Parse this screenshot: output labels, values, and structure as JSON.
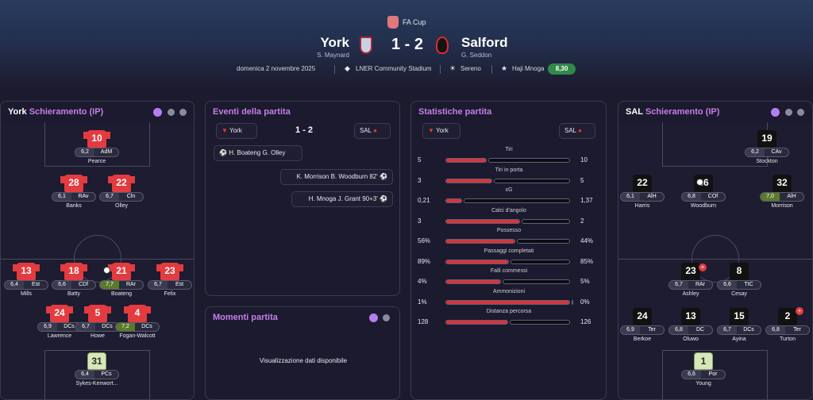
{
  "header": {
    "competition": "FA Cup",
    "home_team": "York",
    "home_manager": "S. Maynard",
    "score": "1 - 2",
    "away_team": "Salford",
    "away_manager": "G. Seddon",
    "date": "domenica 2 novembre 2025",
    "stadium": "LNER Community Stadium",
    "weather": "Sereno",
    "motm": "Haji Mnoga",
    "motm_rating": "8,30"
  },
  "home_lineup": {
    "team": "York",
    "title": "Schieramento (IP)"
  },
  "away_lineup": {
    "team": "SAL",
    "title": "Schieramento (IP)"
  },
  "home_players": [
    {
      "num": "10",
      "rating": "6,2",
      "pos": "AdM",
      "name": "Pearce"
    },
    {
      "num": "28",
      "rating": "6,1",
      "pos": "RAv",
      "name": "Banks"
    },
    {
      "num": "22",
      "rating": "6,7",
      "pos": "Cln",
      "name": "Olley"
    },
    {
      "num": "13",
      "rating": "6,4",
      "pos": "Est",
      "name": "Mills"
    },
    {
      "num": "18",
      "rating": "6,6",
      "pos": "CDf",
      "name": "Batty"
    },
    {
      "num": "21",
      "rating": "7,7",
      "pos": "RAr",
      "name": "Boateng"
    },
    {
      "num": "23",
      "rating": "6,7",
      "pos": "Est",
      "name": "Felix"
    },
    {
      "num": "24",
      "rating": "6,9",
      "pos": "DCs",
      "name": "Lawrence"
    },
    {
      "num": "5",
      "rating": "6,7",
      "pos": "DCs",
      "name": "Howe"
    },
    {
      "num": "4",
      "rating": "7,2",
      "pos": "DCs",
      "name": "Fogan-Walcott"
    },
    {
      "num": "31",
      "rating": "6,4",
      "pos": "PCs",
      "name": "Sykes-Kenwort..."
    }
  ],
  "away_players": [
    {
      "num": "19",
      "rating": "6,2",
      "pos": "CAv",
      "name": "Stockton"
    },
    {
      "num": "22",
      "rating": "6,1",
      "pos": "AlH",
      "name": "Harris"
    },
    {
      "num": "36",
      "rating": "6,8",
      "pos": "COf",
      "name": "Woodburn"
    },
    {
      "num": "32",
      "rating": "7,0",
      "pos": "AlH",
      "name": "Morrison"
    },
    {
      "num": "23",
      "rating": "6,7",
      "pos": "RAr",
      "name": "Ashley"
    },
    {
      "num": "8",
      "rating": "6,6",
      "pos": "TtC",
      "name": "Cesay"
    },
    {
      "num": "24",
      "rating": "6,9",
      "pos": "Ter",
      "name": "Berkoe"
    },
    {
      "num": "13",
      "rating": "6,8",
      "pos": "DC",
      "name": "Oluwo"
    },
    {
      "num": "15",
      "rating": "6,7",
      "pos": "DCs",
      "name": "Ayina"
    },
    {
      "num": "2",
      "rating": "6,8",
      "pos": "Ter",
      "name": "Turton"
    },
    {
      "num": "1",
      "rating": "6,6",
      "pos": "Por",
      "name": "Young"
    }
  ],
  "events": {
    "title": "Eventi della partita",
    "home": "York",
    "score": "1 - 2",
    "away": "SAL",
    "items": [
      {
        "text": "H. Boateng  G. Olley"
      },
      {
        "text": "K. Morrison  B. Woodburn  82'"
      },
      {
        "text": "H. Mnoga  J. Grant  90+3'"
      }
    ]
  },
  "moments": {
    "title": "Momenti partita",
    "empty": "Visualizzazione dati disponibile"
  },
  "stats": {
    "title": "Statistiche partita",
    "home": "York",
    "away": "SAL",
    "rows": [
      {
        "label": "Tiri",
        "home": "5",
        "away": "10",
        "share": 0.333
      },
      {
        "label": "Tiri in porta",
        "home": "3",
        "away": "5",
        "share": 0.375
      },
      {
        "label": "xG",
        "home": "0,21",
        "away": "1,37",
        "share": 0.133
      },
      {
        "label": "Calci d'angolo",
        "home": "3",
        "away": "2",
        "share": 0.6
      },
      {
        "label": "Possesso",
        "home": "56%",
        "away": "44%",
        "share": 0.56
      },
      {
        "label": "Passaggi completati",
        "home": "89%",
        "away": "85%",
        "share": 0.51
      },
      {
        "label": "Falli commessi",
        "home": "4%",
        "away": "5%",
        "share": 0.444
      },
      {
        "label": "Ammonizioni",
        "home": "1%",
        "away": "0%",
        "share": 1.0
      },
      {
        "label": "Distanza percorsa",
        "home": "128",
        "away": "126",
        "share": 0.504
      }
    ]
  },
  "colors": {
    "accent": "#c77fe8",
    "home": "#e33b3f",
    "away": "#111111",
    "good": "#2f8a49"
  }
}
